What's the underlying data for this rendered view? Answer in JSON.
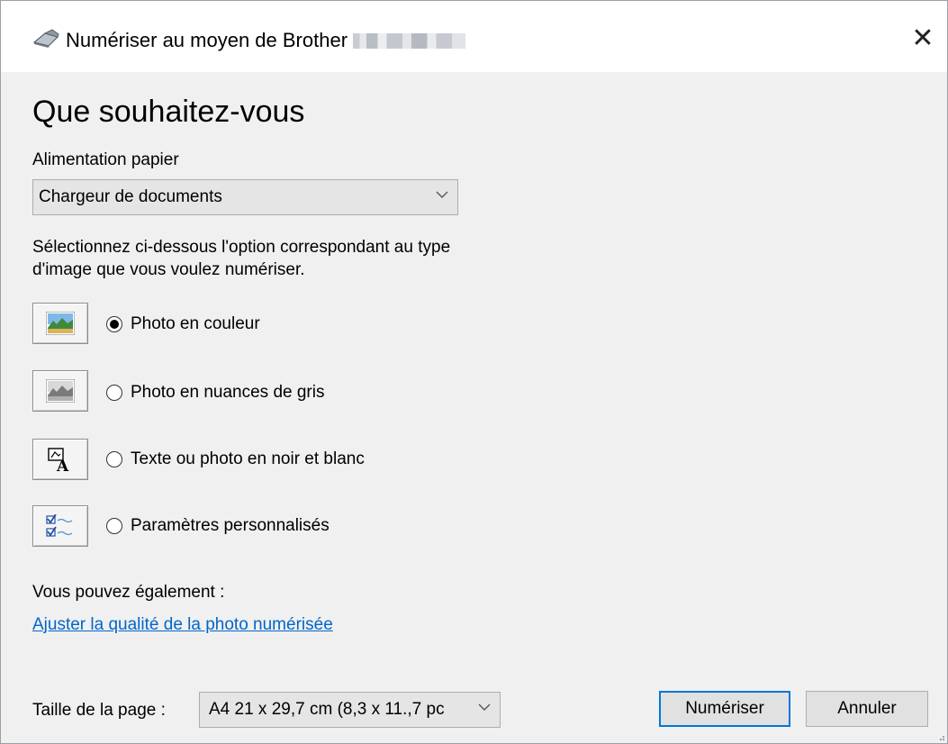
{
  "window": {
    "title": "Numériser au moyen de Brother",
    "title_icon": "scanner-icon",
    "close_icon": "close-icon",
    "close_glyph": "✕"
  },
  "main": {
    "heading": "Que souhaitez-vous",
    "paper_source": {
      "label": "Alimentation papier",
      "value": "Chargeur de documents"
    },
    "description": "Sélectionnez ci-dessous l'option correspondant au type d'image que vous voulez numériser.",
    "options": [
      {
        "label": "Photo en couleur",
        "icon": "color-photo-icon",
        "selected": true
      },
      {
        "label": "Photo en nuances de gris",
        "icon": "grayscale-photo-icon",
        "selected": false
      },
      {
        "label": "Texte ou photo en noir et blanc",
        "icon": "black-white-text-icon",
        "selected": false
      },
      {
        "label": "Paramètres personnalisés",
        "icon": "custom-settings-icon",
        "selected": false
      }
    ],
    "also_label": "Vous pouvez également :",
    "adjust_link": "Ajuster la qualité de la photo numérisée"
  },
  "footer": {
    "page_size_label": "Taille de la page :",
    "page_size_value": "A4 21 x 29,7 cm (8,3 x 11.,7 pc",
    "scan_button": "Numériser",
    "cancel_button": "Annuler"
  },
  "colors": {
    "link": "#0066cc",
    "dialog_bg": "#f0f0f0",
    "default_button_border": "#0078d7"
  }
}
